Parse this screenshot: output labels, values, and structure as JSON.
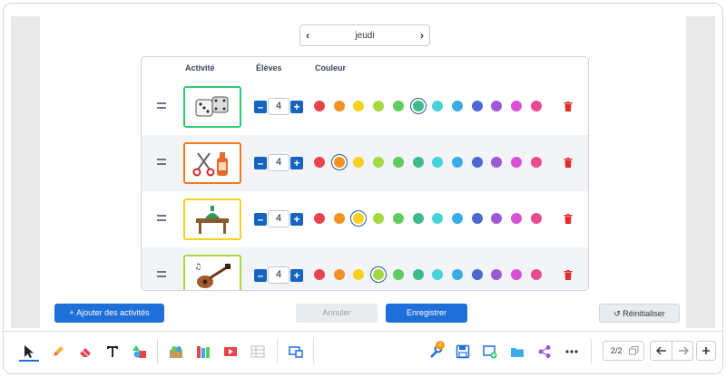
{
  "day_selector": {
    "label": "jeudi"
  },
  "table": {
    "headers": {
      "activity": "Activité",
      "students": "Élèves",
      "color": "Couleur"
    },
    "color_palette": [
      "#e8434f",
      "#f39223",
      "#f5d21f",
      "#a6d843",
      "#5dcc5a",
      "#3dbb8b",
      "#47d1d8",
      "#39abe6",
      "#4c68d3",
      "#9b59d6",
      "#d851d3",
      "#e84a8e"
    ],
    "rows": [
      {
        "activity_icon": "dice-icon",
        "border_color": "#2ecc71",
        "students": "4",
        "selected_color_index": 5
      },
      {
        "activity_icon": "scissors-glue-icon",
        "border_color": "#f07c1e",
        "students": "4",
        "selected_color_index": 1
      },
      {
        "activity_icon": "table-plant-icon",
        "border_color": "#f2d21d",
        "students": "4",
        "selected_color_index": 2
      },
      {
        "activity_icon": "guitar-icon",
        "border_color": "#a6d843",
        "students": "4",
        "selected_color_index": 3
      }
    ]
  },
  "buttons": {
    "add": "Ajouter des activités",
    "cancel": "Annuler",
    "save": "Enregistrer",
    "reset": "Réinitialiser"
  },
  "toolbar": {
    "page_indicator": "2/2",
    "badge_count": "2",
    "tools": [
      "pointer-icon",
      "pencil-icon",
      "eraser-icon",
      "text-icon",
      "shapes-icon",
      "media-icon",
      "library-icon",
      "video-icon",
      "grid-icon",
      "screen-icon",
      "tools-icon",
      "save-icon",
      "add-screen-icon",
      "folder-icon",
      "share-icon",
      "more-icon"
    ]
  }
}
